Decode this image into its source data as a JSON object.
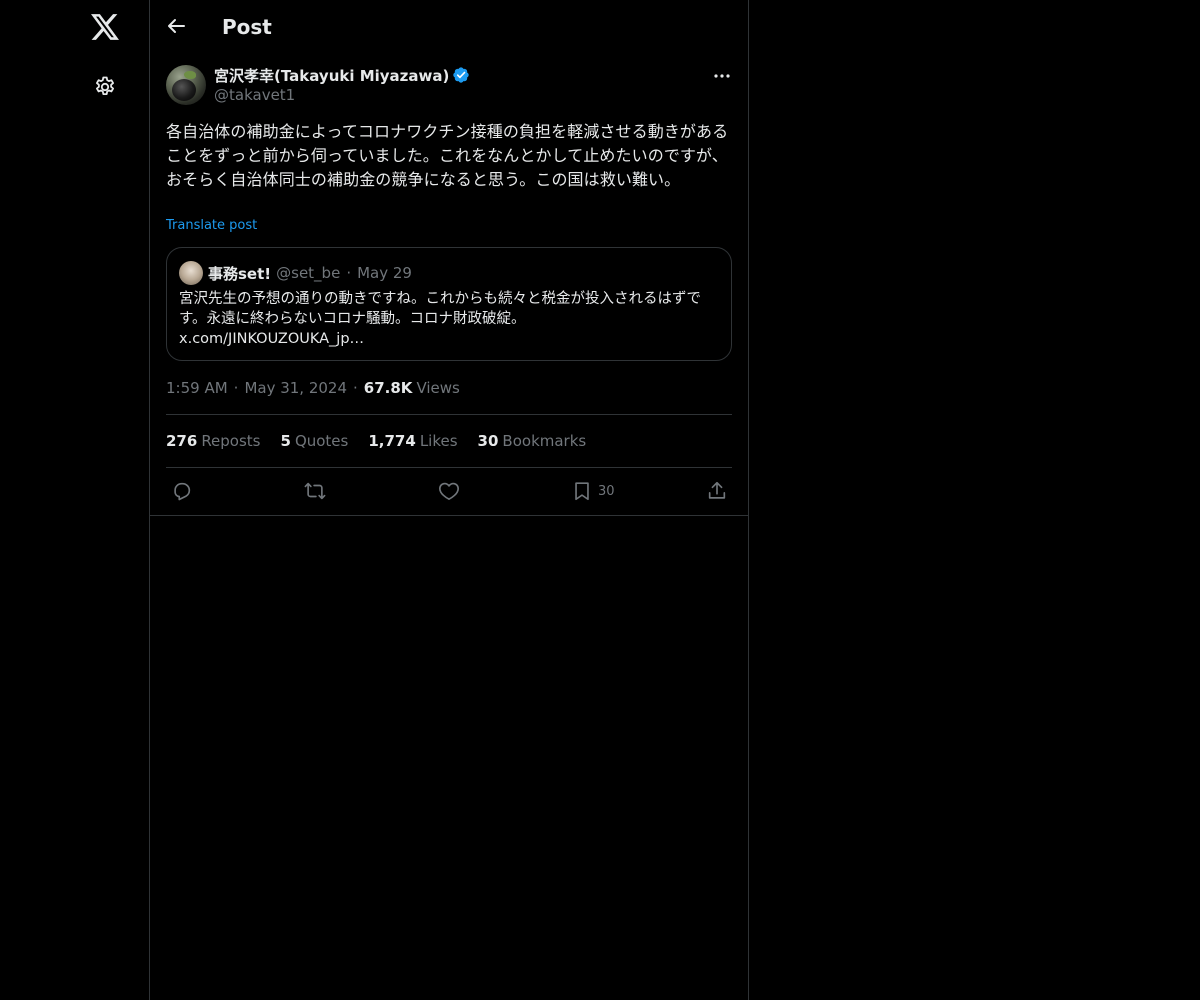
{
  "header": {
    "title": "Post"
  },
  "tweet": {
    "author_name": "宮沢孝幸(Takayuki Miyazawa)",
    "handle": "@takavet1",
    "text": "各自治体の補助金によってコロナワクチン接種の負担を軽減させる動きがあることをずっと前から伺っていました。これをなんとかして止めたいのですが、おそらく自治体同士の補助金の競争になると思う。この国は救い難い。",
    "translate_label": "Translate post",
    "time": "1:59 AM",
    "date": "May 31, 2024",
    "views_count": "67.8K",
    "views_label": "Views"
  },
  "quote": {
    "name": "事務set!",
    "handle": "@set_be",
    "date": "May 29",
    "text": "宮沢先生の予想の通りの動きですね。これからも続々と税金が投入されるはずです。永遠に終わらないコロナ騒動。コロナ財政破綻。",
    "link": "x.com/JINKOUZOUKA_jp…"
  },
  "stats": {
    "reposts_count": "276",
    "reposts_label": "Reposts",
    "quotes_count": "5",
    "quotes_label": "Quotes",
    "likes_count": "1,774",
    "likes_label": "Likes",
    "bookmarks_count": "30",
    "bookmarks_label": "Bookmarks"
  },
  "actions": {
    "reply_icon": "reply-icon",
    "repost_icon": "repost-icon",
    "like_icon": "heart-icon",
    "bookmark_icon": "bookmark-icon",
    "bookmark_count": "30",
    "share_icon": "share-icon"
  },
  "colors": {
    "background": "#000000",
    "text_primary": "#e7e9ea",
    "text_secondary": "#71767b",
    "accent": "#1d9bf0",
    "border": "#2f3336"
  }
}
